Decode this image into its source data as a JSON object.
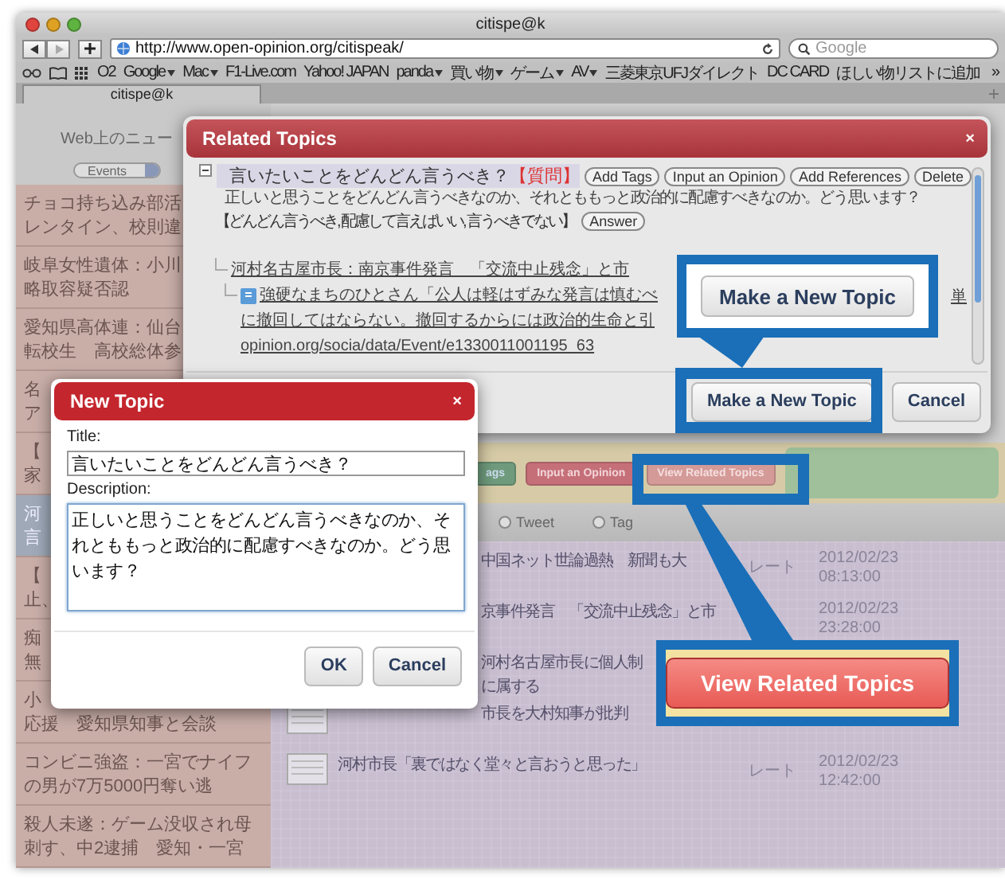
{
  "window": {
    "title": "citispe@k"
  },
  "toolbar": {
    "url": "http://www.open-opinion.org/citispeak/",
    "search_placeholder": "Google"
  },
  "bookmarks": [
    {
      "label": "O2",
      "menu": false
    },
    {
      "label": "Google",
      "menu": true
    },
    {
      "label": "Mac",
      "menu": true
    },
    {
      "label": "F1-Live.com",
      "menu": false
    },
    {
      "label": "Yahoo! JAPAN",
      "menu": false
    },
    {
      "label": "panda",
      "menu": true
    },
    {
      "label": "買い物",
      "menu": true
    },
    {
      "label": "ゲーム",
      "menu": true
    },
    {
      "label": "AV",
      "menu": true
    },
    {
      "label": "三菱東京UFJダイレクト",
      "menu": false
    },
    {
      "label": "DC CARD",
      "menu": false
    },
    {
      "label": "ほしい物リストに追加",
      "menu": false
    }
  ],
  "bookmarks_overflow": "»",
  "tabs": [
    {
      "label": "citispe@k",
      "selected": true
    }
  ],
  "sidebar": {
    "heading": "Web上のニュー",
    "filter": "Events",
    "items": [
      {
        "lines": [
          "チョコ持ち込み部活",
          "レンタイン、校則違"
        ],
        "selected": false
      },
      {
        "lines": [
          "岐阜女性遺体：小川",
          "略取容疑否認"
        ],
        "selected": false
      },
      {
        "lines": [
          "愛知県高体連：仙台",
          "転校生　高校総体参"
        ],
        "selected": false
      },
      {
        "lines": [
          "名",
          "ア"
        ],
        "selected": false
      },
      {
        "lines": [
          "【",
          "家"
        ],
        "selected": false
      },
      {
        "lines": [
          "河",
          "言"
        ],
        "selected": true
      },
      {
        "lines": [
          "【",
          "止、"
        ],
        "selected": false
      },
      {
        "lines": [
          "痴",
          "無"
        ],
        "selected": false
      },
      {
        "lines": [
          "小",
          "応援　愛知県知事と会談"
        ],
        "selected": false
      },
      {
        "lines": [
          "コンビニ強盗：一宮でナイフ",
          "の男が7万5000円奪い逃"
        ],
        "selected": false
      },
      {
        "lines": [
          "殺人未遂：ゲーム没収され母",
          "刺す、中2逮捕　愛知・一宮"
        ],
        "selected": false
      }
    ]
  },
  "topic_actions": [
    {
      "label": "ags",
      "kind": "green"
    },
    {
      "label": "Input an Opinion",
      "kind": "red"
    },
    {
      "label": "View Related Topics",
      "kind": "pale"
    }
  ],
  "filter_radios": [
    {
      "label": "Tweet",
      "selected": false
    },
    {
      "label": "Tag",
      "selected": false
    }
  ],
  "news": [
    {
      "lines": [
        "中国ネット世論過熱　新聞も大"
      ],
      "partial": true,
      "thumbnail": false,
      "rating": "レート",
      "date": "2012/02/23",
      "time": "08:13:00"
    },
    {
      "lines": [
        "京事件発言　「交流中止残念」と市"
      ],
      "partial": true,
      "thumbnail": false,
      "date": "2012/02/23",
      "time": "23:28:00"
    },
    {
      "lines": [
        "河村名古屋市長に個人制",
        "に属する"
      ],
      "partial": true,
      "thumbnail": false
    },
    {
      "lines": [
        "市長を大村知事が批判"
      ],
      "partial": true,
      "thumbnail": true
    },
    {
      "lines": [
        "河村市長「裏ではなく堂々と言おうと思った」"
      ],
      "partial": false,
      "thumbnail": true,
      "rating": "レート",
      "date": "2012/02/23",
      "time": "12:42:00"
    }
  ],
  "related_dialog": {
    "title": "Related Topics",
    "close": "×",
    "topic": {
      "expanded": true,
      "title": "言いたいことをどんどん言うべき？",
      "tag": "【質問】",
      "actions": [
        "Add Tags",
        "Input an Opinion",
        "Add References",
        "Delete"
      ],
      "description": "正しいと思うことをどんどん言うべきなのか、それとももっと政治的に配慮すべきなのか。どう思います？",
      "answers": "【どんどん言うべき, 配慮して言えばいい, 言うべきでない】",
      "answer_button": "Answer"
    },
    "links": [
      {
        "kind": "news",
        "lines": [
          "河村名古屋市長：南京事件発言　「交流中止残念」と市"
        ]
      },
      {
        "kind": "opinion",
        "lines": [
          "強硬なまちのひとさん「公人は軽はずみな発言は慎むべ",
          "に撤回してはならない。撤回するからには政治的生命と引",
          "opinion.org/socia/data/Event/e1330011001195_63"
        ],
        "tail": "単"
      }
    ],
    "buttons": [
      "Make a New Topic",
      "Cancel"
    ]
  },
  "new_topic_dialog": {
    "title": "New Topic",
    "close": "×",
    "title_label": "Title:",
    "title_value": "言いたいことをどんどん言うべき？",
    "description_label": "Description:",
    "description_value": "正しいと思うことをどんどん言うべきなのか、それとももっと政治的に配慮すべきなのか。どう思います？",
    "buttons": [
      "OK",
      "Cancel"
    ]
  },
  "callouts": [
    {
      "label": "Make a New Topic"
    },
    {
      "label": "View Related Topics"
    }
  ]
}
